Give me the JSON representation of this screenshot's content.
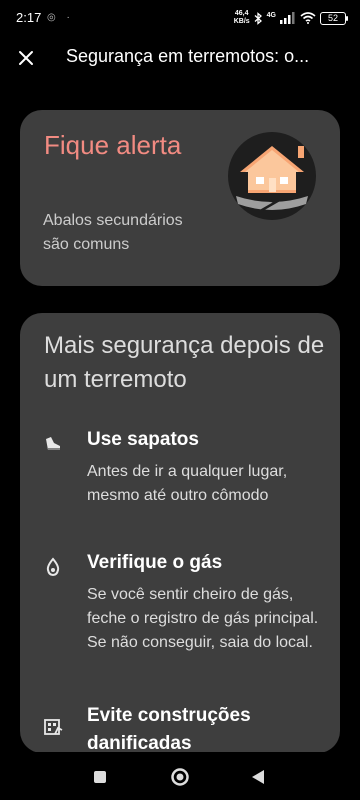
{
  "status_bar": {
    "time": "2:17",
    "net_speed_value": "46,4",
    "net_speed_unit": "KB/s",
    "network_type": "4G",
    "battery_level": "52"
  },
  "header": {
    "title": "Segurança em terremotos: o..."
  },
  "alert_card": {
    "title": "Fique alerta",
    "subtitle": "Abalos secundários são comuns",
    "illustration": "house-crack-icon"
  },
  "tips_card": {
    "title": "Mais segurança depois de um terremoto",
    "tips": [
      {
        "icon": "shoe-icon",
        "heading": "Use sapatos",
        "body": "Antes de ir a qualquer lugar, mesmo até outro cômodo"
      },
      {
        "icon": "gas-flame-icon",
        "heading": "Verifique o gás",
        "body": "Se você sentir cheiro de gás, feche o registro de gás principal. Se não conseguir, saia do local."
      },
      {
        "icon": "damaged-building-icon",
        "heading": "Evite construções danificadas",
        "body": ""
      }
    ]
  },
  "nav": {
    "recents": "recents-square-icon",
    "home": "home-circle-icon",
    "back": "back-triangle-icon"
  }
}
